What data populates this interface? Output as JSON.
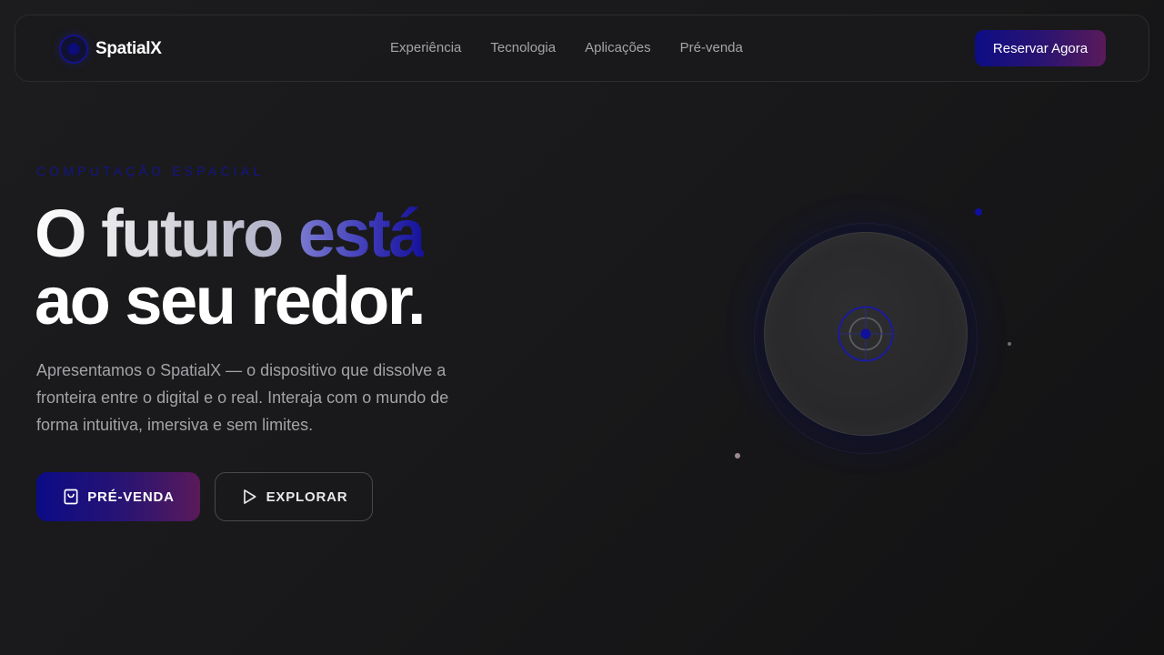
{
  "nav": {
    "logo_text": "SpatialX",
    "links": [
      "Experiência",
      "Tecnologia",
      "Aplicações",
      "Pré-venda"
    ],
    "cta_label": "Reservar Agora"
  },
  "hero": {
    "eyebrow": "COMPUTAÇÃO ESPACIAL",
    "headline_part1": "O futuro ",
    "headline_part2": "está",
    "headline_line2": "ao seu redor.",
    "description": "Apresentamos o SpatialX — o dispositivo que dissolve a fronteira entre o digital e o real. Interaja com o mundo de forma intuitiva, imersiva e sem limites.",
    "primary_button": "PRÉ-VENDA",
    "secondary_button": "EXPLORAR"
  },
  "icons": {
    "logo": "logo-ring-icon",
    "primary_button": "shopping-bag-icon",
    "secondary_button": "play-icon",
    "orb_center": "target-icon"
  },
  "colors": {
    "background": "#19191b",
    "accent": "#0d0d86",
    "accent_end": "#5a1a5a",
    "text_muted": "#a4a4a8"
  }
}
